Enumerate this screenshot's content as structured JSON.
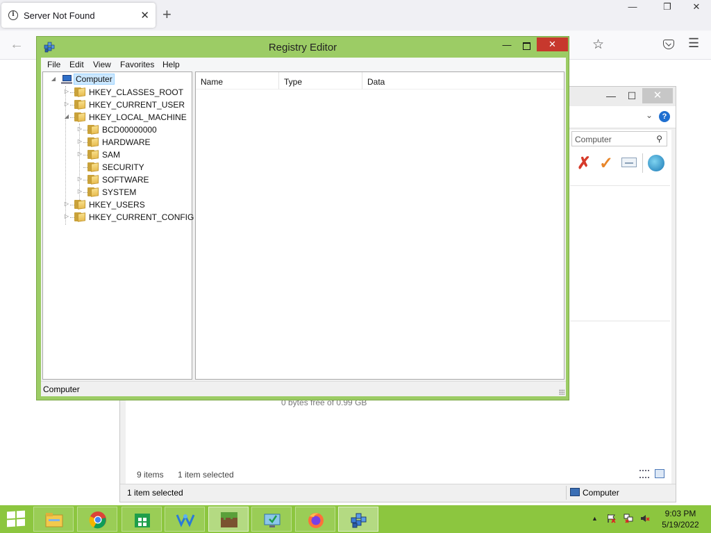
{
  "browser": {
    "tab_title": "Server Not Found",
    "tab_close": "✕",
    "new_tab": "+",
    "min": "—",
    "restore": "❐",
    "close": "✕",
    "back": "←",
    "star": "☆",
    "menu": "☰"
  },
  "explorer": {
    "min": "—",
    "max": "☐",
    "close": "✕",
    "chevron": "⌄",
    "help": "?",
    "search_text": "Computer",
    "search_icon": "⚲",
    "tool_delete": "✗",
    "tool_check": "✓",
    "hidden_text": "0 bytes free of 0.99 GB",
    "items_count": "9 items",
    "items_selected": "1 item selected",
    "status_left": "1 item selected",
    "status_right": "Computer"
  },
  "regedit": {
    "title": "Registry Editor",
    "min": "—",
    "close": "✕",
    "menu": [
      "File",
      "Edit",
      "View",
      "Favorites",
      "Help"
    ],
    "columns": [
      "Name",
      "Type",
      "Data"
    ],
    "status": "Computer",
    "tree": {
      "root": "Computer",
      "hives": [
        "HKEY_CLASSES_ROOT",
        "HKEY_CURRENT_USER",
        "HKEY_LOCAL_MACHINE",
        "HKEY_USERS",
        "HKEY_CURRENT_CONFIG"
      ],
      "hklm_children": [
        "BCD00000000",
        "HARDWARE",
        "SAM",
        "SECURITY",
        "SOFTWARE",
        "SYSTEM"
      ]
    },
    "expand_collapsed": "▷",
    "expand_open": "◢"
  },
  "taskbar": {
    "apps": [
      "file-explorer",
      "chrome",
      "store",
      "network-app",
      "minecraft",
      "remote-app",
      "firefox",
      "regedit"
    ],
    "tray_up": "▲",
    "time": "9:03 PM",
    "date": "5/19/2022"
  }
}
